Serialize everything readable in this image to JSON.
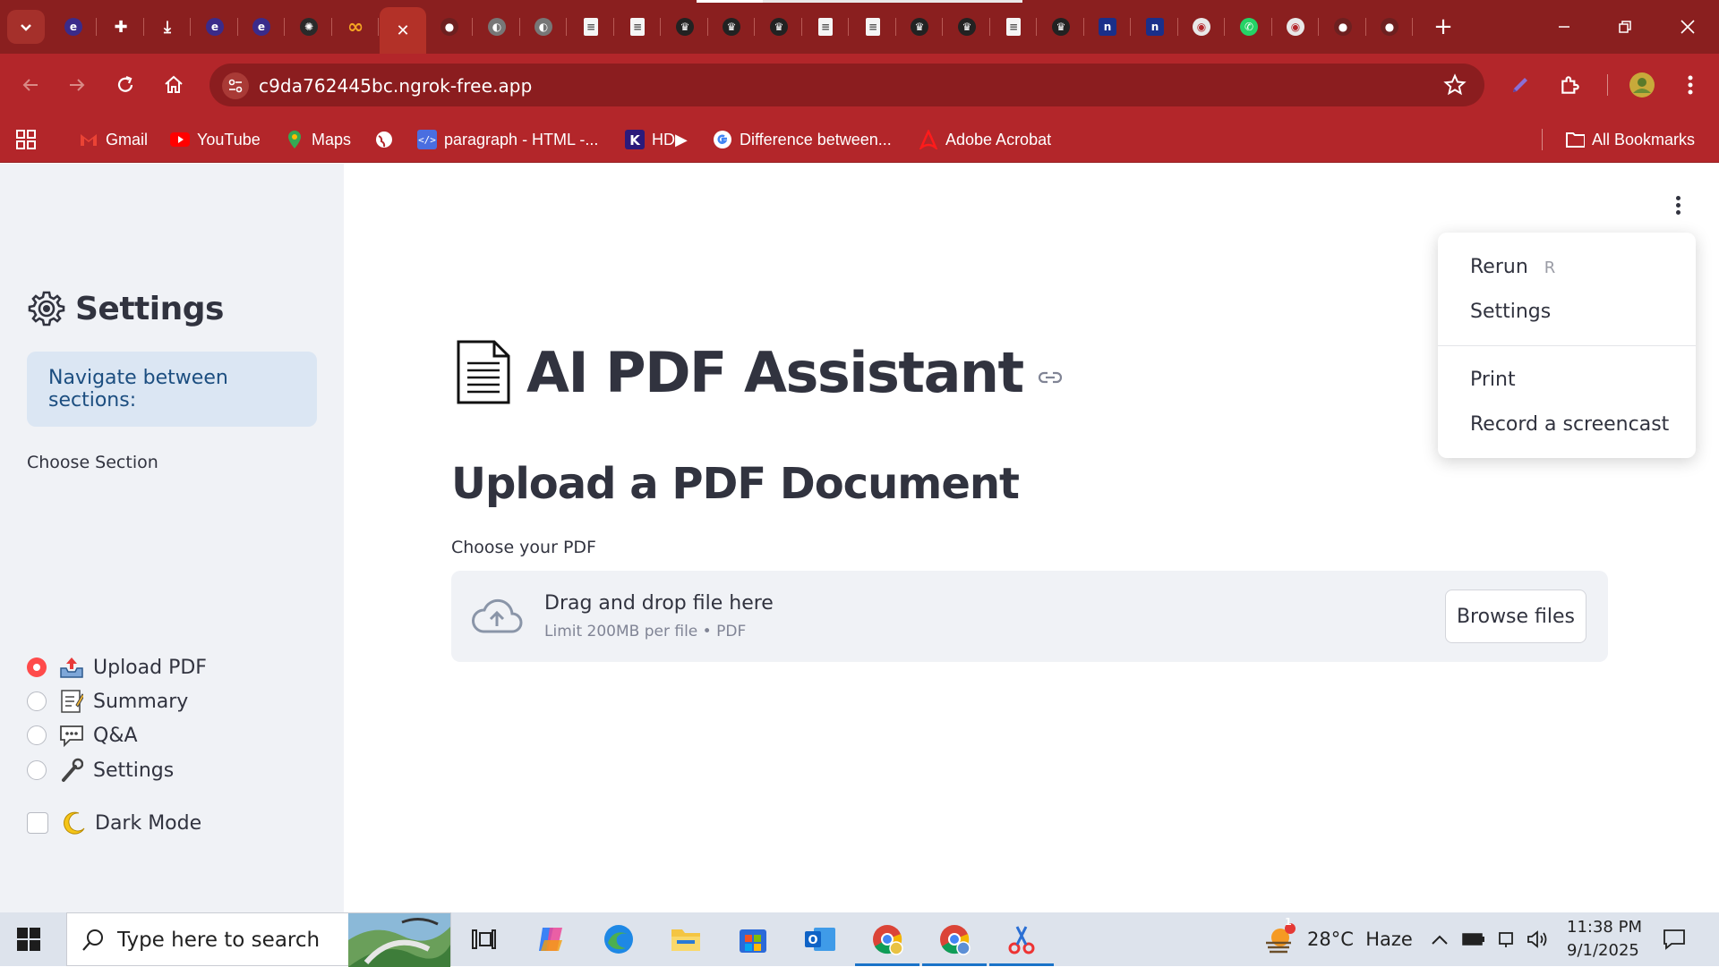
{
  "browser": {
    "url": "c9da762445bc.ngrok-free.app",
    "tab_icons": [
      "favicon",
      "extensions-icon",
      "download-icon",
      "favicon",
      "favicon",
      "openai-icon",
      "meta-infinity-icon",
      "close-icon",
      "github-icon",
      "globe-icon",
      "globe-icon",
      "document-icon",
      "document-icon",
      "crown-icon",
      "crown-icon",
      "crown-icon",
      "document-icon",
      "document-icon",
      "crown-icon",
      "crown-icon",
      "document-icon",
      "crown-icon",
      "n-icon",
      "n-icon",
      "chrome-icon",
      "whatsapp-icon",
      "chrome-icon",
      "github-icon",
      "github-icon"
    ],
    "colors": {
      "tabstrip": "#8a1f1f",
      "toolbar": "#b3262a",
      "omnibox": "#8b1d1f"
    }
  },
  "bookmarks": {
    "items": [
      {
        "label": "Gmail",
        "icon": "gmail-icon"
      },
      {
        "label": "YouTube",
        "icon": "youtube-icon"
      },
      {
        "label": "Maps",
        "icon": "maps-icon"
      },
      {
        "label": "",
        "icon": "globe-icon"
      },
      {
        "label": "paragraph - HTML -...",
        "icon": "code-icon"
      },
      {
        "label": "HD▶",
        "icon": "k-icon"
      },
      {
        "label": "Difference between...",
        "icon": "google-icon"
      },
      {
        "label": "Adobe Acrobat",
        "icon": "acrobat-icon"
      }
    ],
    "all_bookmarks": "All Bookmarks"
  },
  "sidebar": {
    "title": "Settings",
    "info": "Navigate between sections:",
    "choose_label": "Choose Section",
    "options": [
      {
        "label": "Upload PDF",
        "selected": true
      },
      {
        "label": "Summary",
        "selected": false
      },
      {
        "label": "Q&A",
        "selected": false
      },
      {
        "label": "Settings",
        "selected": false
      }
    ],
    "dark_mode_label": "Dark Mode",
    "dark_mode_checked": false
  },
  "main": {
    "title": "AI PDF Assistant",
    "subtitle": "Upload a PDF Document",
    "uploader_label": "Choose your PDF",
    "drop_title": "Drag and drop file here",
    "drop_limit": "Limit 200MB per file • PDF",
    "browse_label": "Browse files",
    "accent": "#ff4b4b"
  },
  "menu": {
    "items": [
      {
        "label": "Rerun",
        "shortcut": "R"
      },
      {
        "label": "Settings",
        "shortcut": ""
      },
      {
        "label": "Print",
        "shortcut": ""
      },
      {
        "label": "Record a screencast",
        "shortcut": ""
      }
    ]
  },
  "taskbar": {
    "search_placeholder": "Type here to search",
    "weather": "28°C  Haze",
    "weather_badge": "1",
    "time": "11:38 PM",
    "date": "9/1/2025"
  }
}
